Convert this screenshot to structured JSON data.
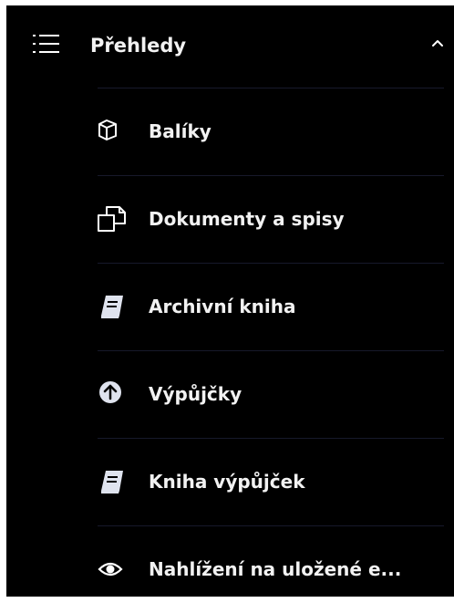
{
  "section": {
    "title": "Přehledy",
    "expanded": true
  },
  "items": [
    {
      "label": "Balíky",
      "icon": "package-icon"
    },
    {
      "label": "Dokumenty a spisy",
      "icon": "documents-icon"
    },
    {
      "label": "Archivní kniha",
      "icon": "book-icon"
    },
    {
      "label": "Výpůjčky",
      "icon": "upload-circle-icon"
    },
    {
      "label": "Kniha výpůjček",
      "icon": "book-icon"
    },
    {
      "label": "Nahlížení na uložené e...",
      "icon": "eye-icon"
    }
  ],
  "colors": {
    "background": "#000000",
    "text": "#f2f2f2",
    "divider": "#17192b"
  }
}
